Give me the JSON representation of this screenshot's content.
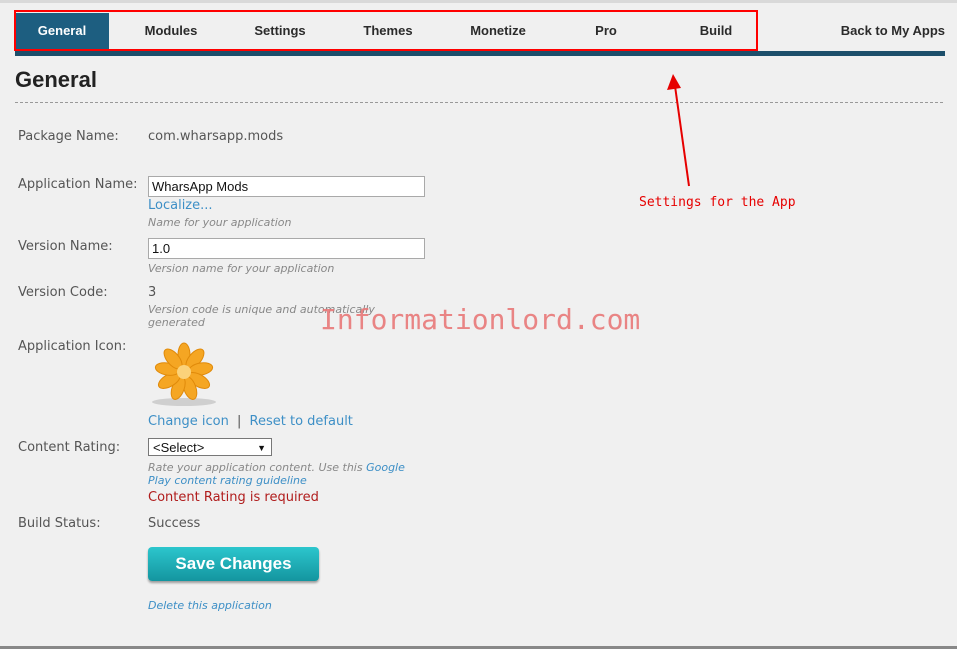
{
  "nav": {
    "tabs": [
      {
        "label": "General",
        "active": true
      },
      {
        "label": "Modules"
      },
      {
        "label": "Settings"
      },
      {
        "label": "Themes"
      },
      {
        "label": "Monetize"
      },
      {
        "label": "Pro"
      },
      {
        "label": "Build"
      }
    ],
    "back_link": "Back to My Apps",
    "active_color": "#1d5e80"
  },
  "page": {
    "title": "General"
  },
  "form": {
    "package_name": {
      "label": "Package Name:",
      "value": "com.wharsapp.mods"
    },
    "application_name": {
      "label": "Application Name:",
      "value": "WharsApp Mods",
      "localize": "Localize...",
      "hint": "Name for your application"
    },
    "version_name": {
      "label": "Version Name:",
      "value": "1.0",
      "hint": "Version name for your application"
    },
    "version_code": {
      "label": "Version Code:",
      "value": "3",
      "hint_line1": "Version code is unique and automatically",
      "hint_line2": "generated"
    },
    "application_icon": {
      "label": "Application Icon:",
      "icon": "orange-flower-icon",
      "change": "Change icon",
      "separator": "|",
      "reset": "Reset to default"
    },
    "content_rating": {
      "label": "Content Rating:",
      "selected": "<Select>",
      "hint_prefix": "Rate your application content. Use this ",
      "hint_link1": "Google",
      "hint_link2": "Play content rating guideline",
      "error": "Content Rating is required",
      "error_color": "#b01c1c"
    },
    "build_status": {
      "label": "Build Status:",
      "value": "Success"
    }
  },
  "actions": {
    "save": "Save Changes",
    "delete": "Delete this application"
  },
  "overlay": {
    "watermark": "Informationlord.com",
    "annotation": "Settings for the App",
    "annotation_color": "#e60000"
  }
}
